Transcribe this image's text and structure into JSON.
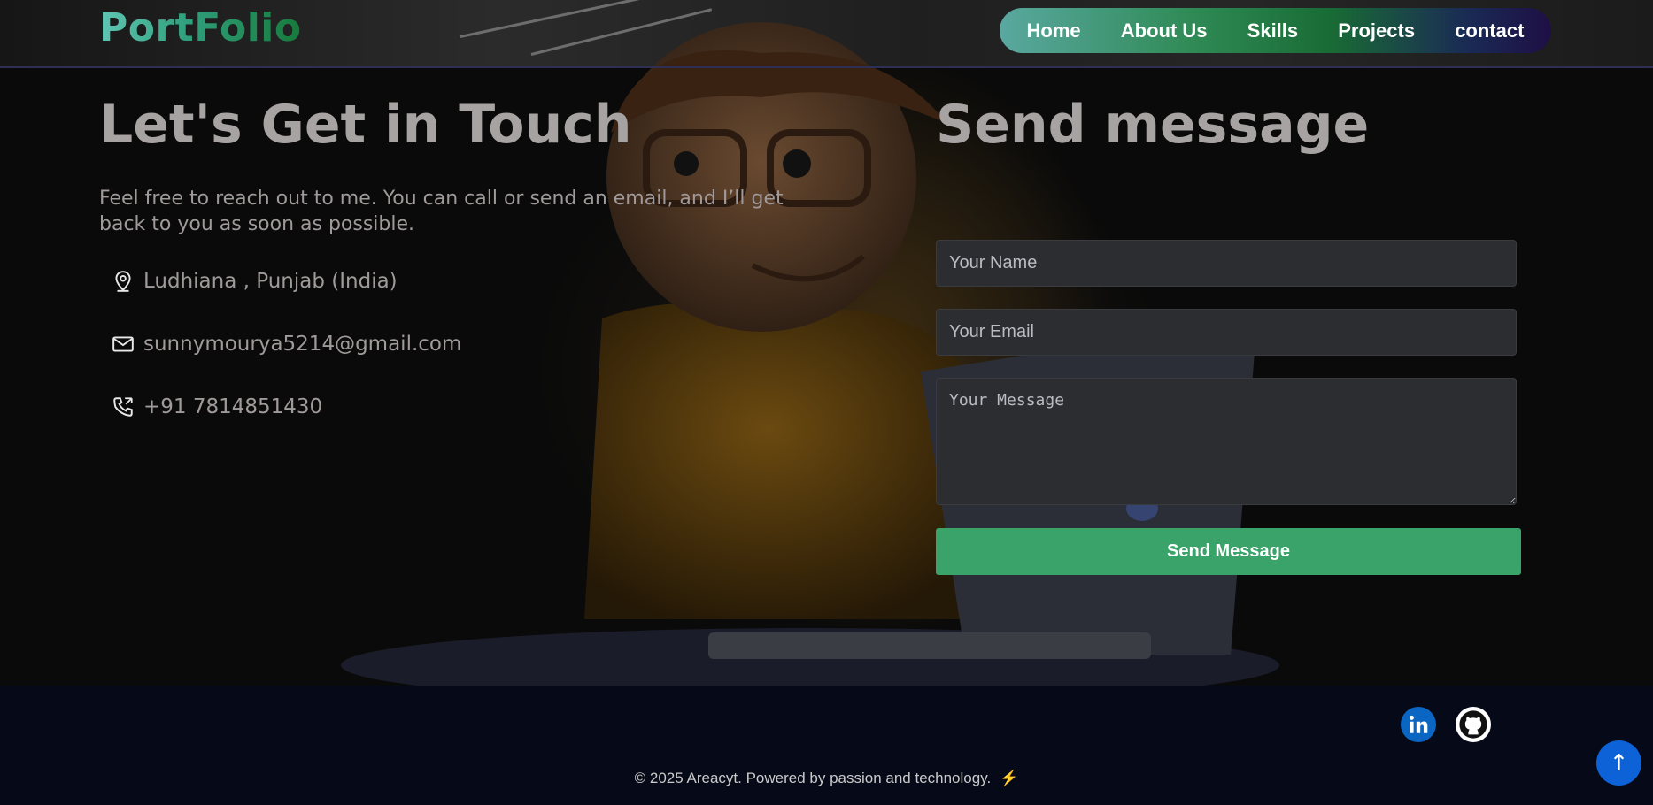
{
  "header": {
    "logo": "PortFolio",
    "nav": [
      "Home",
      "About Us",
      "Skills",
      "Projects",
      "contact"
    ]
  },
  "contact_info": {
    "heading": "Let's Get in Touch",
    "intro": "Feel free to reach out to me. You can call or send an email, and I’ll get back to you as soon as possible.",
    "location": "Ludhiana , Punjab (India)",
    "email": "sunnymourya5214@gmail.com",
    "phone": "+91 7814851430"
  },
  "form": {
    "heading": "Send message",
    "name_placeholder": "Your Name",
    "email_placeholder": "Your Email",
    "message_placeholder": "Your Message",
    "submit_label": "Send Message"
  },
  "footer": {
    "social_icons": [
      "linkedin-icon",
      "github-icon"
    ],
    "copyright": "© 2025 Areacyt. Powered by passion and technology.",
    "bolt": "⚡",
    "back_to_top": "↑"
  },
  "colors": {
    "accent_green": "#3aa36a",
    "back_to_top_blue": "#0d62d8",
    "linkedin_blue": "#0a66c2",
    "footer_bg": "#060a18"
  }
}
